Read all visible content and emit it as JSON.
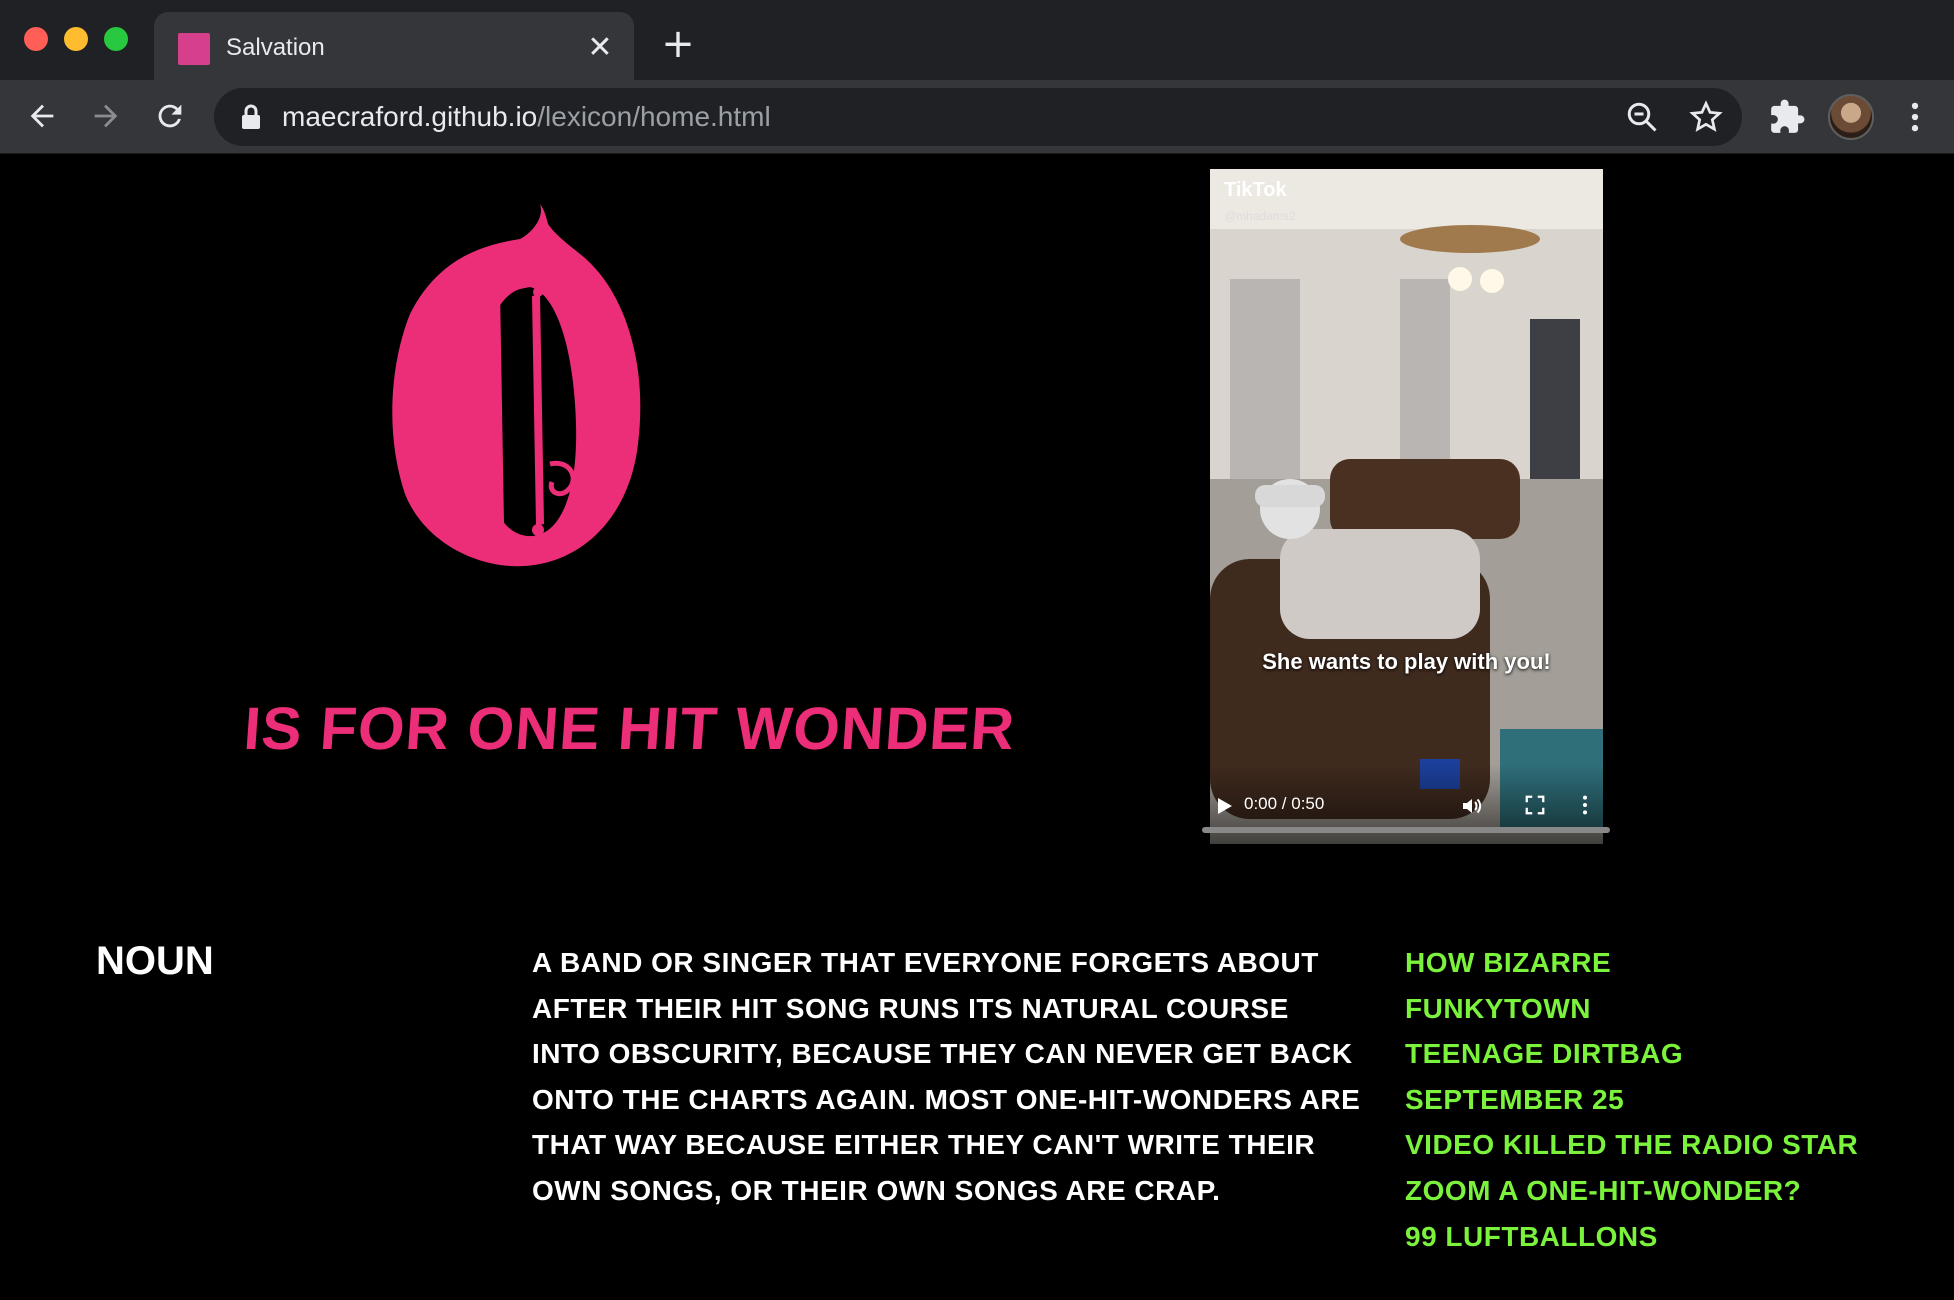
{
  "browser": {
    "tab_title": "Salvation",
    "tab_close": "✕",
    "new_tab": "+",
    "url_host": "maecraford.github.io",
    "url_path": "/lexicon/home.html"
  },
  "entry": {
    "letter": "O",
    "headline": "is for one hit wonder",
    "part_of_speech": "noun",
    "definition": "A band or singer that everyone forgets about after their hit song runs its natural course into obscurity, because they can never get back onto the charts again. Most one-hit-wonders are that way because either they can't write their own songs, or their own songs are crap.",
    "examples": [
      "How Bizarre",
      "Funkytown",
      "Teenage Dirtbag",
      "September 25",
      "Video Killed the Radio Star",
      "Zoom a one-hit-wonder?",
      "99 Luftballons"
    ]
  },
  "video": {
    "brand": "TikTok",
    "user": "@mhadams2",
    "caption": "She wants to play with you!",
    "time": "0:00 / 0:50",
    "progress": 0
  },
  "colors": {
    "accent_pink": "#ec2e78",
    "accent_green": "#7bf23c",
    "background": "#000000"
  }
}
